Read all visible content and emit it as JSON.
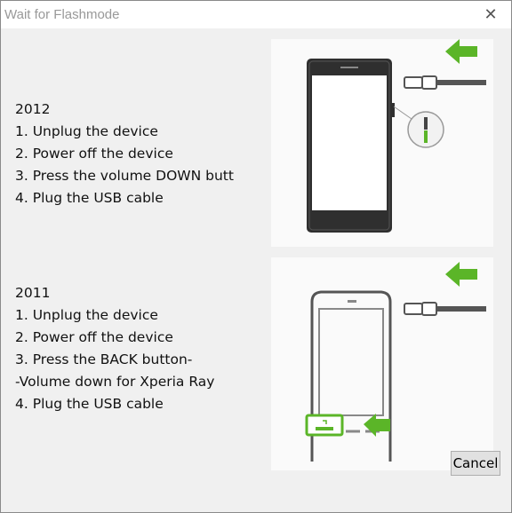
{
  "window": {
    "title": "Wait for Flashmode",
    "close_glyph": "✕"
  },
  "section_2012": {
    "heading": "2012",
    "steps": [
      "1.  Unplug the device",
      "2.  Power off the device",
      "3.  Press the volume DOWN butt",
      "4.  Plug the USB cable"
    ]
  },
  "section_2011": {
    "heading": "2011",
    "steps": [
      "1.  Unplug the device",
      "2.  Power off the device",
      "3.  Press the BACK button-",
      "-Volume down for Xperia Ray",
      "4.  Plug the USB cable"
    ]
  },
  "buttons": {
    "cancel": "Cancel"
  },
  "colors": {
    "accent_green": "#5bb528",
    "device_dark": "#3a3a3a"
  },
  "icons": [
    "close-icon",
    "arrow-left-icon",
    "usb-cable-icon",
    "volume-button-icon",
    "back-button-icon"
  ]
}
